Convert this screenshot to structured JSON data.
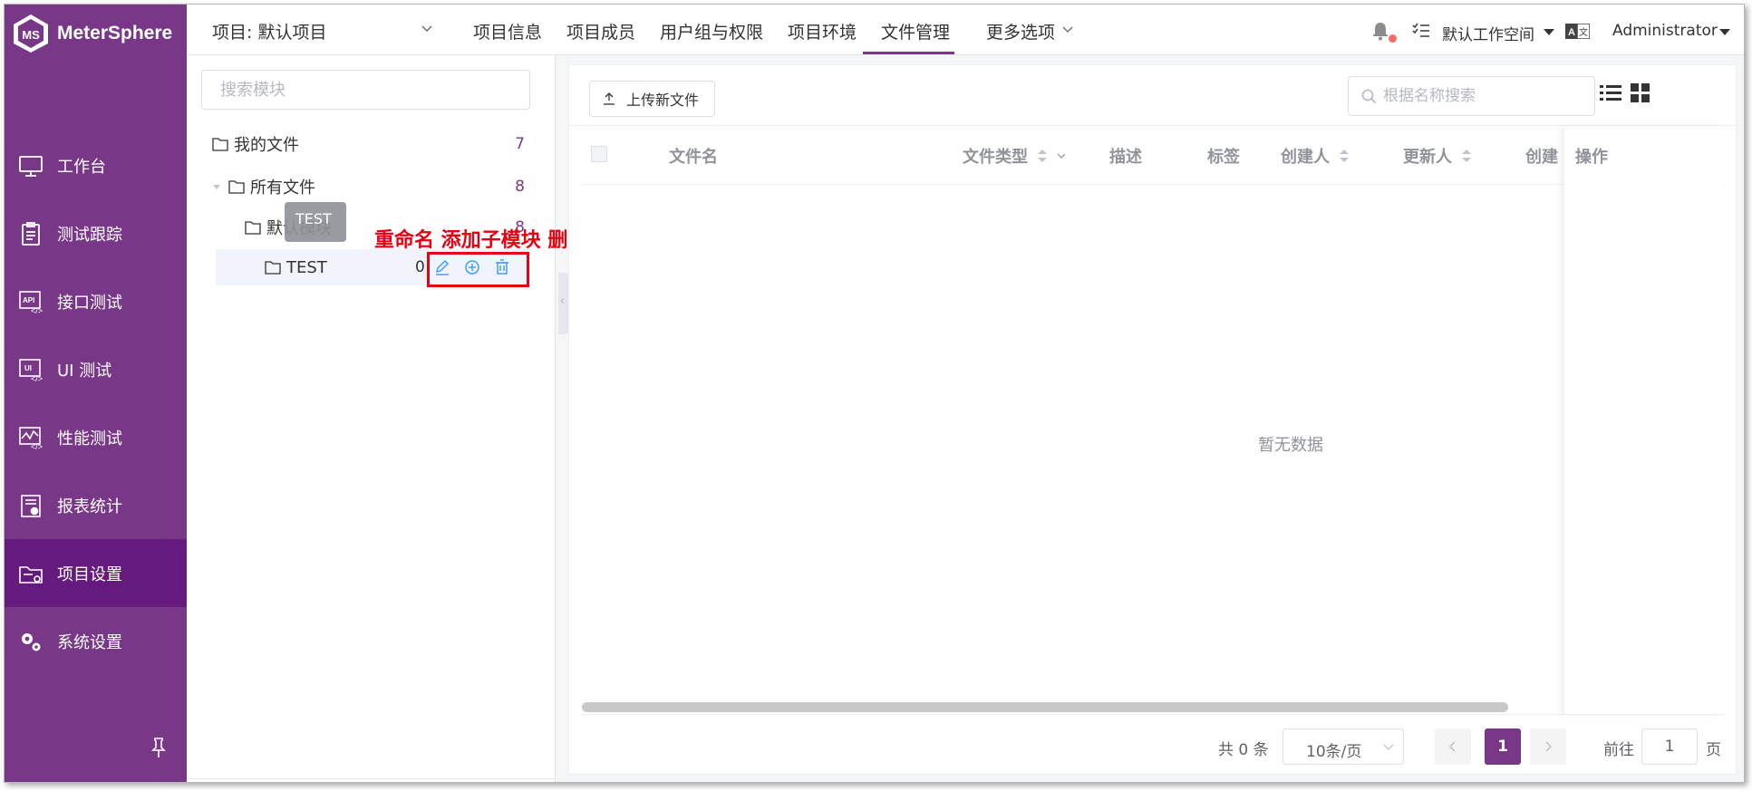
{
  "app": {
    "name": "MeterSphere"
  },
  "sidebar": {
    "items": [
      {
        "label": "工作台",
        "icon": "monitor-icon"
      },
      {
        "label": "测试跟踪",
        "icon": "clipboard-icon"
      },
      {
        "label": "接口测试",
        "icon": "api-icon"
      },
      {
        "label": "UI 测试",
        "icon": "ui-icon"
      },
      {
        "label": "性能测试",
        "icon": "chart-icon"
      },
      {
        "label": "报表统计",
        "icon": "report-icon"
      },
      {
        "label": "项目设置",
        "icon": "folder-settings-icon",
        "active": true
      },
      {
        "label": "系统设置",
        "icon": "gears-icon"
      }
    ]
  },
  "header": {
    "project": "项目: 默认项目",
    "tabs": [
      "项目信息",
      "项目成员",
      "用户组与权限",
      "项目环境",
      "文件管理",
      "更多选项"
    ],
    "active_tab": "文件管理",
    "workspace": "默认工作空间",
    "user": "Administrator"
  },
  "modules": {
    "search_placeholder": "搜索模块",
    "my_files": {
      "label": "我的文件",
      "count": "7"
    },
    "all_files": {
      "label": "所有文件",
      "count": "8"
    },
    "default_module": {
      "label": "默认模块",
      "count": "8"
    },
    "test_module": {
      "label": "TEST",
      "count": "0"
    },
    "tooltip": "TEST",
    "annotation": "重命名 添加子模块 删除"
  },
  "files": {
    "upload_label": "上传新文件",
    "search_placeholder": "根据名称搜索",
    "columns": [
      "文件名",
      "文件类型",
      "描述",
      "标签",
      "创建人",
      "更新人",
      "创建"
    ],
    "actions_column": "操作",
    "empty_text": "暂无数据"
  },
  "pagination": {
    "total": "共 0 条",
    "page_size": "10条/页",
    "current_page": "1",
    "goto_label": "前往",
    "goto_value": "1",
    "page_suffix": "页"
  },
  "colors": {
    "brand": "#783887",
    "brand_active": "#651b7e",
    "annotation": "#e60012"
  }
}
